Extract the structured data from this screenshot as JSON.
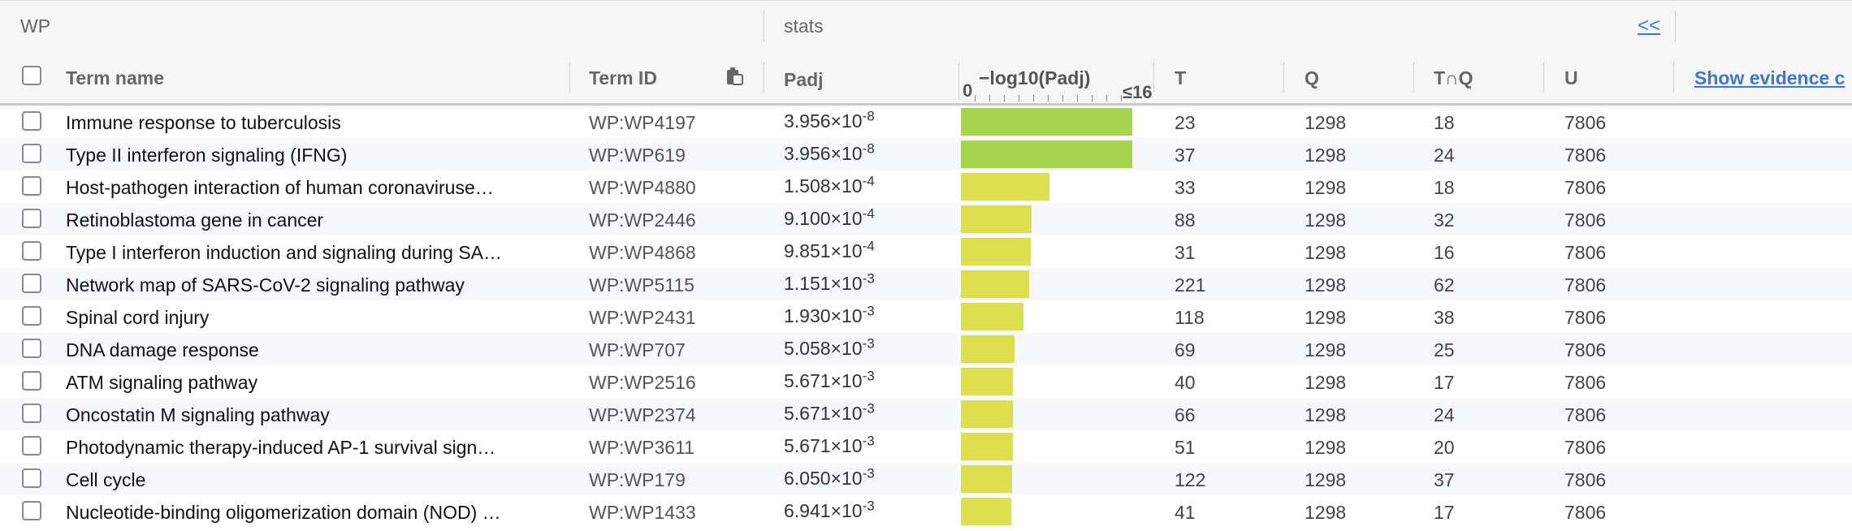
{
  "group_header": {
    "wp": "WP",
    "stats": "stats",
    "collapse_glyph": "<<"
  },
  "columns": {
    "term_name": "Term name",
    "term_id": "Term ID",
    "padj": "Padj",
    "neglog": "−log10(Padj)",
    "axis_min": "0",
    "axis_max": "≤16",
    "t": "T",
    "q": "Q",
    "tq": "T∩Q",
    "u": "U",
    "show_evidence": "Show evidence c"
  },
  "colors": {
    "bar_green": "#a8d54f",
    "bar_yellow": "#dde04e",
    "link": "#3a78d8"
  },
  "icons": {
    "copy": "clipboard-icon",
    "collapse": "double-chevron-left-icon"
  },
  "rows": [
    {
      "term": "Immune response to tuberculosis",
      "id": "WP:WP4197",
      "mant": "3.956×10",
      "exp": "-8",
      "neglog": 7.4,
      "t": "23",
      "q": "1298",
      "tq": "18",
      "u": "7806",
      "color": "#a8d54f"
    },
    {
      "term": "Type II interferon signaling (IFNG)",
      "id": "WP:WP619",
      "mant": "3.956×10",
      "exp": "-8",
      "neglog": 7.4,
      "t": "37",
      "q": "1298",
      "tq": "24",
      "u": "7806",
      "color": "#a8d54f"
    },
    {
      "term": "Host-pathogen interaction of human coronaviruse…",
      "id": "WP:WP4880",
      "mant": "1.508×10",
      "exp": "-4",
      "neglog": 3.82,
      "t": "33",
      "q": "1298",
      "tq": "18",
      "u": "7806",
      "color": "#dde04e"
    },
    {
      "term": "Retinoblastoma gene in cancer",
      "id": "WP:WP2446",
      "mant": "9.100×10",
      "exp": "-4",
      "neglog": 3.04,
      "t": "88",
      "q": "1298",
      "tq": "32",
      "u": "7806",
      "color": "#dde04e"
    },
    {
      "term": "Type I interferon induction and signaling during SA…",
      "id": "WP:WP4868",
      "mant": "9.851×10",
      "exp": "-4",
      "neglog": 3.01,
      "t": "31",
      "q": "1298",
      "tq": "16",
      "u": "7806",
      "color": "#dde04e"
    },
    {
      "term": "Network map of SARS-CoV-2 signaling pathway",
      "id": "WP:WP5115",
      "mant": "1.151×10",
      "exp": "-3",
      "neglog": 2.94,
      "t": "221",
      "q": "1298",
      "tq": "62",
      "u": "7806",
      "color": "#dde04e"
    },
    {
      "term": "Spinal cord injury",
      "id": "WP:WP2431",
      "mant": "1.930×10",
      "exp": "-3",
      "neglog": 2.71,
      "t": "118",
      "q": "1298",
      "tq": "38",
      "u": "7806",
      "color": "#dde04e"
    },
    {
      "term": "DNA damage response",
      "id": "WP:WP707",
      "mant": "5.058×10",
      "exp": "-3",
      "neglog": 2.3,
      "t": "69",
      "q": "1298",
      "tq": "25",
      "u": "7806",
      "color": "#dde04e"
    },
    {
      "term": "ATM signaling pathway",
      "id": "WP:WP2516",
      "mant": "5.671×10",
      "exp": "-3",
      "neglog": 2.25,
      "t": "40",
      "q": "1298",
      "tq": "17",
      "u": "7806",
      "color": "#dde04e"
    },
    {
      "term": "Oncostatin M signaling pathway",
      "id": "WP:WP2374",
      "mant": "5.671×10",
      "exp": "-3",
      "neglog": 2.25,
      "t": "66",
      "q": "1298",
      "tq": "24",
      "u": "7806",
      "color": "#dde04e"
    },
    {
      "term": "Photodynamic therapy-induced AP-1 survival sign…",
      "id": "WP:WP3611",
      "mant": "5.671×10",
      "exp": "-3",
      "neglog": 2.25,
      "t": "51",
      "q": "1298",
      "tq": "20",
      "u": "7806",
      "color": "#dde04e"
    },
    {
      "term": "Cell cycle",
      "id": "WP:WP179",
      "mant": "6.050×10",
      "exp": "-3",
      "neglog": 2.22,
      "t": "122",
      "q": "1298",
      "tq": "37",
      "u": "7806",
      "color": "#dde04e"
    },
    {
      "term": "Nucleotide-binding oligomerization domain (NOD) …",
      "id": "WP:WP1433",
      "mant": "6.941×10",
      "exp": "-3",
      "neglog": 2.16,
      "t": "41",
      "q": "1298",
      "tq": "17",
      "u": "7806",
      "color": "#dde04e"
    }
  ]
}
